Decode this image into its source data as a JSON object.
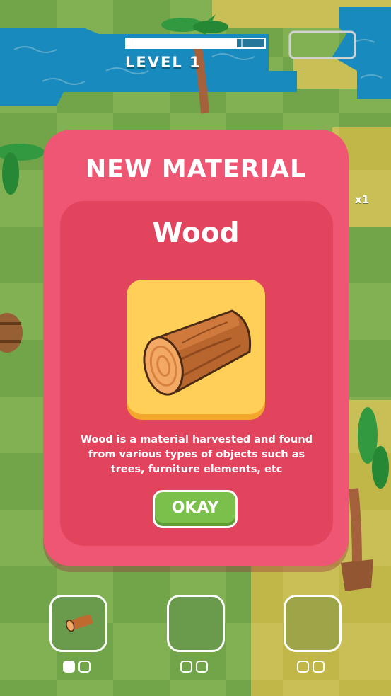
{
  "hud": {
    "level_label": "LEVEL 1",
    "progress_fraction": 0.8,
    "progress_segments": 6,
    "multiplier": "x1"
  },
  "modal": {
    "title": "NEW MATERIAL",
    "material_name": "Wood",
    "material_icon": "wood-log-icon",
    "description_lines": [
      "Wood is a material harvested and found",
      "from various types of objects such as",
      "trees, furniture elements, etc"
    ],
    "okay_label": "OKAY"
  },
  "material_slots": [
    {
      "item": "wood-log-icon",
      "color": "#6a9a4c",
      "dots": [
        true,
        false
      ]
    },
    {
      "item": null,
      "color": "#6a9a4c",
      "dots": [
        false,
        false
      ]
    },
    {
      "item": null,
      "color": "#9ea548",
      "dots": [
        false,
        false
      ]
    }
  ],
  "colors": {
    "modal": "#ee5674",
    "panel": "#e3445d",
    "tile": "#ffcf58",
    "button": "#7bc04a",
    "water": "#1ea9e8",
    "grass_light": "#a5dc6e",
    "grass_dark": "#8cc95a",
    "sand": "#f5ea6a"
  }
}
